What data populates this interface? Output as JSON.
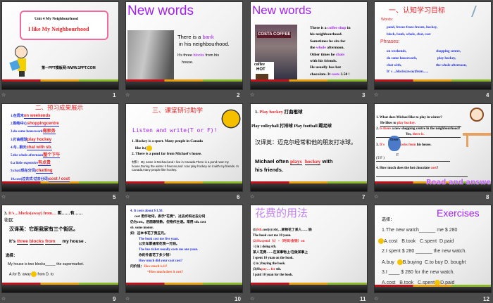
{
  "slide_numbers": [
    "1",
    "2",
    "3",
    "4",
    "5",
    "6",
    "7",
    "8",
    "9",
    "10",
    "11",
    "12"
  ],
  "s1": {
    "unit": "Unit 4  My Neighbourhood",
    "title": "I like My Neighbourhood",
    "site": "第一PPT模板网-WWW.1PPT.COM"
  },
  "s2": {
    "title": "New words",
    "l1a": "There is a ",
    "l1b": "bank",
    "l2": "in his neighbourhood.",
    "l3a": "It's three ",
    "l3b": "blocks",
    "l3c": " from his",
    "l4": "house."
  },
  "s3": {
    "title": "New words",
    "sign": "COSTA COFFEE",
    "cup1": "coffee",
    "cup2": "HOT",
    "lines": [
      "There is a coffee shop in",
      "his neighbourhood.",
      "Sometimes he sits for",
      "the whole afternoon.",
      "Other times he chats",
      "with his friends.",
      "He usually has hot",
      "chocolate. It costs 3.50 !"
    ]
  },
  "s4": {
    "title": "一、认知学习目标",
    "words_label": "Words:",
    "words": [
      "pond,  freeze-froze-frozen,   hockey,",
      "block,  bank,  whole,  chat,  cost"
    ],
    "phrases_label": "Phrases:",
    "phrases": [
      [
        "on weekends,",
        "shopping centre,"
      ],
      [
        "do some housework,",
        "play hockey,"
      ],
      [
        "chat with,",
        "the whole afternoon,"
      ]
    ],
    "phrase_last": "It' s ...blocks(away)from......"
  },
  "s5": {
    "title": "二、预习成果展示",
    "items": [
      [
        "1.在周末",
        "on weekends"
      ],
      [
        "2.购物中心",
        "shoppingcentre"
      ],
      [
        "3.do some housework",
        "做家务"
      ],
      [
        "3.打曲棍球",
        "play hockey"
      ],
      [
        "4.与...聊天",
        "chat with sb."
      ],
      [
        "5.the whole afternoon",
        "整个下午"
      ],
      [
        "6.a little expensive",
        "有点贵"
      ],
      [
        "9.chat(现在分词)",
        "chatting"
      ],
      [
        "10.cost(过去式/过去分词)",
        "cost  /  cost"
      ]
    ]
  },
  "s6": {
    "title": "三、课堂研讨助学",
    "sub": "Listen and write(T or F)!",
    "q1a": "1. Hockey  is a sport. Many  people  in Canada",
    "q1b": "like it.(",
    "q2": "2. There is a pond  far  from  Michael's house.",
    "material": "材料：My name is Michael,and I live in Canada.There is a pond near my house.During the winter it freezes,and I can play hockey on it  with my friends. In Canada,many people like hockey."
  },
  "s7": {
    "l1a": "1. ",
    "l1b": "Play hockey",
    "l1c": " 打曲棍球",
    "l2": "Play volleyball  打排球 Play football    踢足球",
    "l3": "汉译英：迈克尔经常和他的朋友打冰球。",
    "l4a": "Michael  often ",
    "l4b": "plays",
    "l4c": "hockey",
    "l4d": " with",
    "l5": "his friends."
  },
  "s8": {
    "q1": "1. What does Michael like to play in winter?",
    "a1a": "He  likes to ",
    "a1b": "play  hockey.",
    "q2a": "2. ",
    "q2b": "Is there",
    "q2c": " a new shopping centre in the neighbourhood?",
    "a2a": "Yes, ",
    "a2b": "there is.",
    "q3a": "3. ",
    "q3b": "It's",
    "q3c": " blocks from",
    "q3d": " his house.",
    "bubble": "three",
    "tf": "(T/F )",
    "tf_ans": "F",
    "q4a": "4. How much does the hot chocolate ",
    "q4b": "cost",
    "q4c": "?",
    "banner": "Read and answer!"
  },
  "s9": {
    "l1a": "3. ",
    "l1b": "It's…blocks(away) from…",
    "l1c": "  距……有……",
    "l1d": "街区",
    "l2": "汉译英：它距我家有三个街区。",
    "l3a": "It's ",
    "blank1": "three",
    "blank2": "blocks",
    "blank3": "from",
    "l3b": " my  house .",
    "l4": "选择：",
    "l5": "My house is two blocks_____ the supermarket.",
    "l6a": "A.for B. away",
    "l6b": "from   D. to"
  },
  "s10": {
    "l1": "4. It costs about $ 3.50.",
    "l2": "cost 用作动词，表示“花费”，过去式和过去分词",
    "l3": "仍为cost。后面跟钱数，但物作主语。常用 sth. cost",
    "l4": "sb. some money.",
    "l5": "如：这本书花了我五元。",
    "l6": "The book cost me five yuan.",
    "l7": "公交车票通常花我一元钱。",
    "l8": "The bus ticket usually costs me one yuan.",
    "l9": "你的外套花了多少钱?",
    "l10": "How  much  did  your coat cost?",
    "l11a": "问价钱：",
    "l11b": "How much is it?",
    "l12": "=How much does it cost?"
  },
  "s11": {
    "title": "花费的用法",
    "lines": [
      [
        "(1)",
        "Sth.",
        "cost(s) (sb)…某物花了某人……钱"
      ],
      [
        "",
        "",
        "The book cost me 10 yuan."
      ],
      [
        "",
        "(2)Sh.spend（s）+（时间/金钱）on",
        "sth."
      ],
      [
        "",
        "",
        "/ ( in ) doing sth."
      ],
      [
        "",
        "",
        "某人花费……在某事物上/在做某事上"
      ],
      [
        "",
        "",
        "I spent 10 yuan on the book."
      ],
      [
        "",
        "",
        "/( in ) buying the book."
      ],
      [
        "(3)Sh.",
        "pay… for",
        "sth."
      ],
      [
        "",
        "",
        "I paid 10 yuan for the book."
      ]
    ]
  },
  "s12": {
    "title": "Exercises",
    "l0": "选择：",
    "q1": "1.The new watch______  me $ 280",
    "o1": [
      "A.cost",
      "B.took",
      "C.spent",
      "D.paid"
    ],
    "q2": "2.I  spent $ 280 ______ the new watch.",
    "o2": [
      "A.buy",
      "B.buying",
      "C.to buy",
      "D. bought"
    ],
    "q3": "3.I  ____ $ 280  for the new watch.",
    "o3": [
      "A.cost",
      "B.took",
      "C.spent",
      "D.paid"
    ]
  }
}
